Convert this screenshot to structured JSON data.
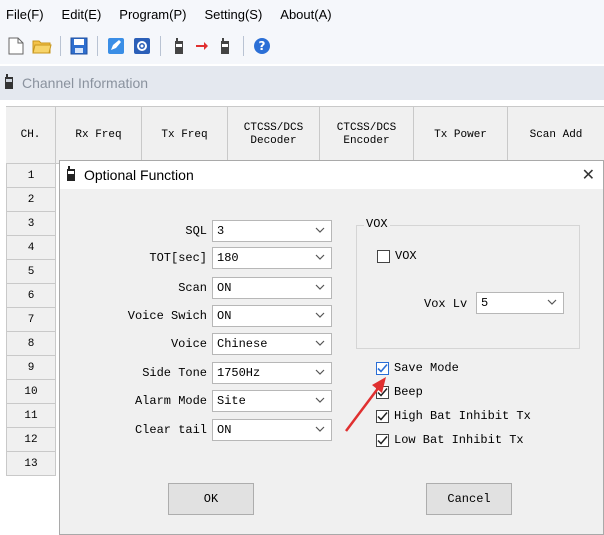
{
  "menubar": {
    "items": [
      "File(F)",
      "Edit(E)",
      "Program(P)",
      "Setting(S)",
      "About(A)"
    ]
  },
  "toolbar": {
    "icons": [
      "new-file-icon",
      "open-folder-icon",
      "save-icon",
      "edit-icon",
      "settings-icon",
      "read-radio-icon",
      "write-radio-icon",
      "help-icon"
    ]
  },
  "channel_panel": {
    "title": "Channel Information",
    "headers": [
      "CH.",
      "Rx Freq",
      "Tx Freq",
      "CTCSS/DCS\nDecoder",
      "CTCSS/DCS\nEncoder",
      "Tx Power",
      "Scan Add"
    ],
    "rows": [
      "1",
      "2",
      "3",
      "4",
      "5",
      "6",
      "7",
      "8",
      "9",
      "10",
      "11",
      "12",
      "13"
    ]
  },
  "dialog": {
    "title": "Optional Function",
    "fields": {
      "sql": {
        "label": "SQL",
        "value": "3"
      },
      "tot": {
        "label": "TOT[sec]",
        "value": "180"
      },
      "scan": {
        "label": "Scan",
        "value": "ON"
      },
      "voice_switch": {
        "label": "Voice Swich",
        "value": "ON"
      },
      "voice": {
        "label": "Voice",
        "value": "Chinese"
      },
      "side_tone": {
        "label": "Side Tone",
        "value": "1750Hz"
      },
      "alarm_mode": {
        "label": "Alarm Mode",
        "value": "Site"
      },
      "clear_tail": {
        "label": "Clear tail",
        "value": "ON"
      }
    },
    "vox_group": {
      "label": "VOX",
      "vox_checkbox": {
        "label": "VOX",
        "checked": false
      },
      "vox_level": {
        "label": "Vox Lv",
        "value": "5"
      }
    },
    "checkboxes": {
      "save_mode": {
        "label": "Save Mode",
        "checked": true
      },
      "beep": {
        "label": "Beep",
        "checked": true
      },
      "high_bat": {
        "label": "High Bat Inhibit Tx",
        "checked": true
      },
      "low_bat": {
        "label": "Low Bat Inhibit Tx",
        "checked": true
      }
    },
    "ok_label": "OK",
    "cancel_label": "Cancel"
  },
  "colors": {
    "accent_check": "#2a6ed6",
    "annotation_arrow": "#e03030"
  }
}
